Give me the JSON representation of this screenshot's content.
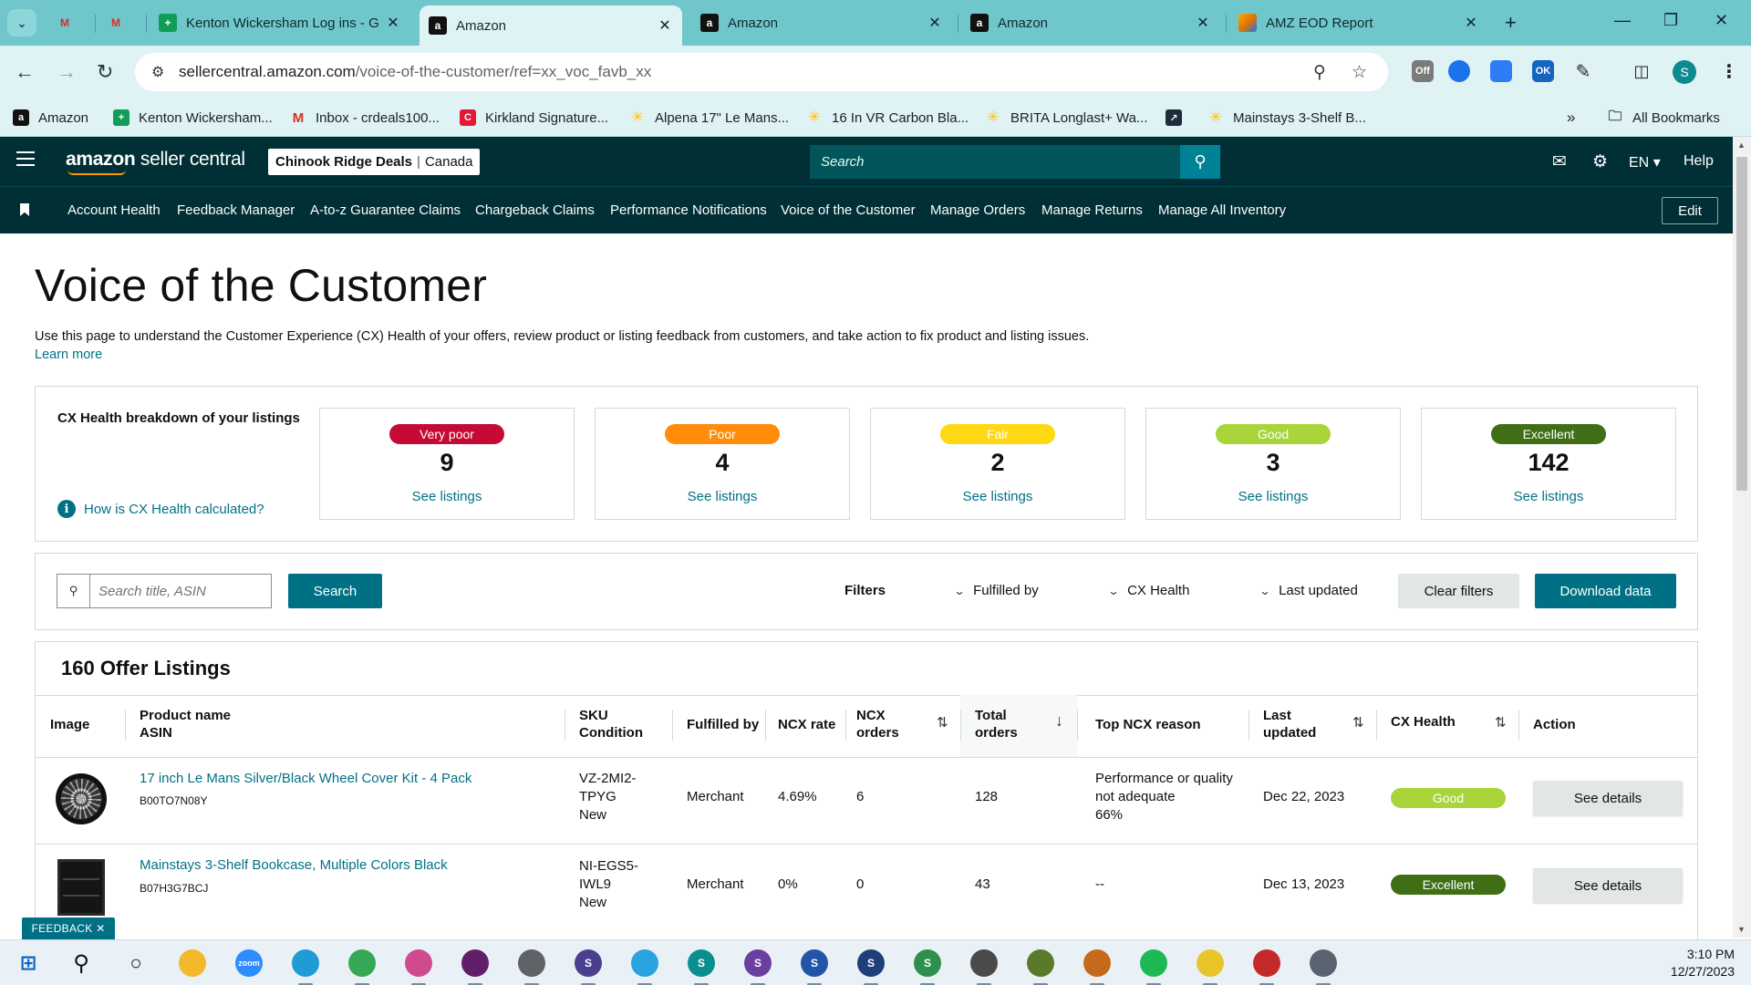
{
  "browser": {
    "tabs": [
      {
        "title": "",
        "favicon": "gmail-icon",
        "active": false
      },
      {
        "title": "",
        "favicon": "gmail-icon",
        "active": false
      },
      {
        "title": "Kenton Wickersham Log ins - G",
        "favicon": "sheets-icon",
        "active": false
      },
      {
        "title": "Amazon",
        "favicon": "amazon-icon",
        "active": true
      },
      {
        "title": "Amazon",
        "favicon": "amazon-icon",
        "active": false
      },
      {
        "title": "Amazon",
        "favicon": "amazon-icon",
        "active": false
      },
      {
        "title": "AMZ EOD Report",
        "favicon": "report-icon",
        "active": false
      }
    ],
    "url_host": "sellercentral.amazon.com",
    "url_path": "/voice-of-the-customer/ref=xx_voc_favb_xx",
    "profile_initial": "S",
    "extensions": [
      {
        "name": "off-extension-icon",
        "label": "Off",
        "color": "#7a7a7a"
      },
      {
        "name": "puzzle-blue-extension-icon",
        "label": "",
        "color": "#1a73e8"
      },
      {
        "name": "pin-extension-icon",
        "label": "",
        "color": "#2e7df6"
      },
      {
        "name": "ok-extension-icon",
        "label": "OK",
        "color": "#1565c0"
      }
    ],
    "bookmarks": [
      {
        "label": "Amazon",
        "icon": "amazon-icon",
        "color": "#111111"
      },
      {
        "label": "Kenton Wickersham...",
        "icon": "sheets-icon",
        "color": "#0f9d58"
      },
      {
        "label": "Inbox - crdeals100...",
        "icon": "gmail-icon",
        "color": "#d93025"
      },
      {
        "label": "Kirkland Signature...",
        "icon": "costco-icon",
        "color": "#e31837"
      },
      {
        "label": "Alpena 17\" Le Mans...",
        "icon": "walmart-icon",
        "color": "#ffc220"
      },
      {
        "label": "16 In VR Carbon Bla...",
        "icon": "walmart-icon",
        "color": "#ffc220"
      },
      {
        "label": "BRITA Longlast+ Wa...",
        "icon": "walmart-icon",
        "color": "#ffc220"
      },
      {
        "label": "",
        "icon": "dark-site-icon",
        "color": "#1d2b3a"
      },
      {
        "label": "Mainstays 3-Shelf B...",
        "icon": "walmart-icon",
        "color": "#ffc220"
      }
    ],
    "all_bookmarks": "All Bookmarks"
  },
  "header": {
    "logo_bold": "amazon",
    "logo_rest": " seller central",
    "store_name": "Chinook Ridge Deals",
    "store_region": "Canada",
    "search_placeholder": "Search",
    "language": "EN",
    "help": "Help"
  },
  "nav": {
    "items": [
      "Account Health",
      "Feedback Manager",
      "A-to-z Guarantee Claims",
      "Chargeback Claims",
      "Performance Notifications",
      "Voice of the Customer",
      "Manage Orders",
      "Manage Returns",
      "Manage All Inventory"
    ],
    "edit": "Edit"
  },
  "page": {
    "title": "Voice of the Customer",
    "description": "Use this page to understand the Customer Experience (CX) Health of your offers, review product or listing feedback from customers, and take action to fix product and listing issues.",
    "learn_more": "Learn more"
  },
  "cx": {
    "label": "CX Health breakdown of your listings",
    "how_link": "How is CX Health calculated?",
    "cards": [
      {
        "badge": "Very poor",
        "count": "9",
        "link": "See listings",
        "bg": "#c40a35",
        "fg": "#ffffff"
      },
      {
        "badge": "Poor",
        "count": "4",
        "link": "See listings",
        "bg": "#ff8c0a",
        "fg": "#ffffff"
      },
      {
        "badge": "Fair",
        "count": "2",
        "link": "See listings",
        "bg": "#ffd814",
        "fg": "#ffffff"
      },
      {
        "badge": "Good",
        "count": "3",
        "link": "See listings",
        "bg": "#a9d43a",
        "fg": "#ffffff"
      },
      {
        "badge": "Excellent",
        "count": "142",
        "link": "See listings",
        "bg": "#3f6e15",
        "fg": "#ffffff"
      }
    ]
  },
  "filters": {
    "search_placeholder": "Search title, ASIN",
    "search_button": "Search",
    "label": "Filters",
    "dropdowns": [
      "Fulfilled by",
      "CX Health",
      "Last updated"
    ],
    "clear": "Clear filters",
    "download": "Download data"
  },
  "listings": {
    "title": "160 Offer Listings",
    "columns": {
      "image": "Image",
      "product_l1": "Product name",
      "product_l2": "ASIN",
      "sku_l1": "SKU",
      "sku_l2": "Condition",
      "fulfilled": "Fulfilled by",
      "ncx_rate": "NCX rate",
      "ncx_orders_l1": "NCX",
      "ncx_orders_l2": "orders",
      "total_l1": "Total",
      "total_l2": "orders",
      "reason": "Top NCX reason",
      "updated_l1": "Last",
      "updated_l2": "updated",
      "health": "CX Health",
      "action": "Action"
    },
    "rows": [
      {
        "name": "17 inch Le Mans Silver/Black Wheel Cover Kit - 4 Pack",
        "asin": "B00TO7N08Y",
        "sku_l1": "VZ-2MI2-",
        "sku_l2": "TPYG",
        "condition": "New",
        "fulfilled": "Merchant",
        "ncx_rate": "4.69%",
        "ncx_orders": "6",
        "total_orders": "128",
        "reason_l1": "Performance or quality",
        "reason_l2": "not adequate",
        "reason_l3": "66%",
        "updated": "Dec 22, 2023",
        "health": "Good",
        "health_bg": "#a9d43a",
        "action": "See details",
        "thumb": "wheel-cover-image"
      },
      {
        "name": "Mainstays 3-Shelf Bookcase, Multiple Colors Black",
        "asin": "B07H3G7BCJ",
        "sku_l1": "NI-EGS5-",
        "sku_l2": "IWL9",
        "condition": "New",
        "fulfilled": "Merchant",
        "ncx_rate": "0%",
        "ncx_orders": "0",
        "total_orders": "43",
        "reason_l1": "--",
        "reason_l2": "",
        "reason_l3": "",
        "updated": "Dec 13, 2023",
        "health": "Excellent",
        "health_bg": "#3f6e15",
        "action": "See details",
        "thumb": "bookcase-image"
      }
    ]
  },
  "feedback": "FEEDBACK",
  "taskbar": {
    "time": "3:10 PM",
    "date": "12/27/2023",
    "icons": [
      {
        "name": "file-explorer-icon",
        "color": "#f2b92b",
        "text": ""
      },
      {
        "name": "zoom-icon",
        "color": "#2d8cff",
        "text": "zoom"
      },
      {
        "name": "edge-icon",
        "color": "#1f9bd6",
        "text": ""
      },
      {
        "name": "chrome-icon",
        "color": "#34a853",
        "text": ""
      },
      {
        "name": "snipping-tool-icon",
        "color": "#d04a8f",
        "text": ""
      },
      {
        "name": "slack-icon",
        "color": "#611f69",
        "text": ""
      },
      {
        "name": "chrome-profile-icon",
        "color": "#5f6368",
        "text": ""
      },
      {
        "name": "chrome-profile-s-icon",
        "color": "#4a3f8f",
        "text": "S"
      },
      {
        "name": "telegram-icon",
        "color": "#2aa3df",
        "text": ""
      },
      {
        "name": "chrome-profile-teal-icon",
        "color": "#0a8f8f",
        "text": "S"
      },
      {
        "name": "chrome-profile-purple-icon",
        "color": "#6a3fa0",
        "text": "S"
      },
      {
        "name": "chrome-profile-blue-icon",
        "color": "#2255aa",
        "text": "S"
      },
      {
        "name": "chrome-profile-navy-icon",
        "color": "#1f3f7a",
        "text": "S"
      },
      {
        "name": "chrome-profile-green-icon",
        "color": "#2f8f4f",
        "text": "S"
      },
      {
        "name": "chrome-profile-mono-icon",
        "color": "#4a4a4a",
        "text": ""
      },
      {
        "name": "chrome-profile-olive-icon",
        "color": "#5a7a2a",
        "text": ""
      },
      {
        "name": "chrome-profile-orange-icon",
        "color": "#c46a1a",
        "text": ""
      },
      {
        "name": "spotify-icon",
        "color": "#1db954",
        "text": ""
      },
      {
        "name": "sticky-notes-icon",
        "color": "#e8c52a",
        "text": ""
      },
      {
        "name": "chrome-profile-red-icon",
        "color": "#c42a2a",
        "text": ""
      },
      {
        "name": "calculator-icon",
        "color": "#5a6470",
        "text": ""
      }
    ]
  }
}
